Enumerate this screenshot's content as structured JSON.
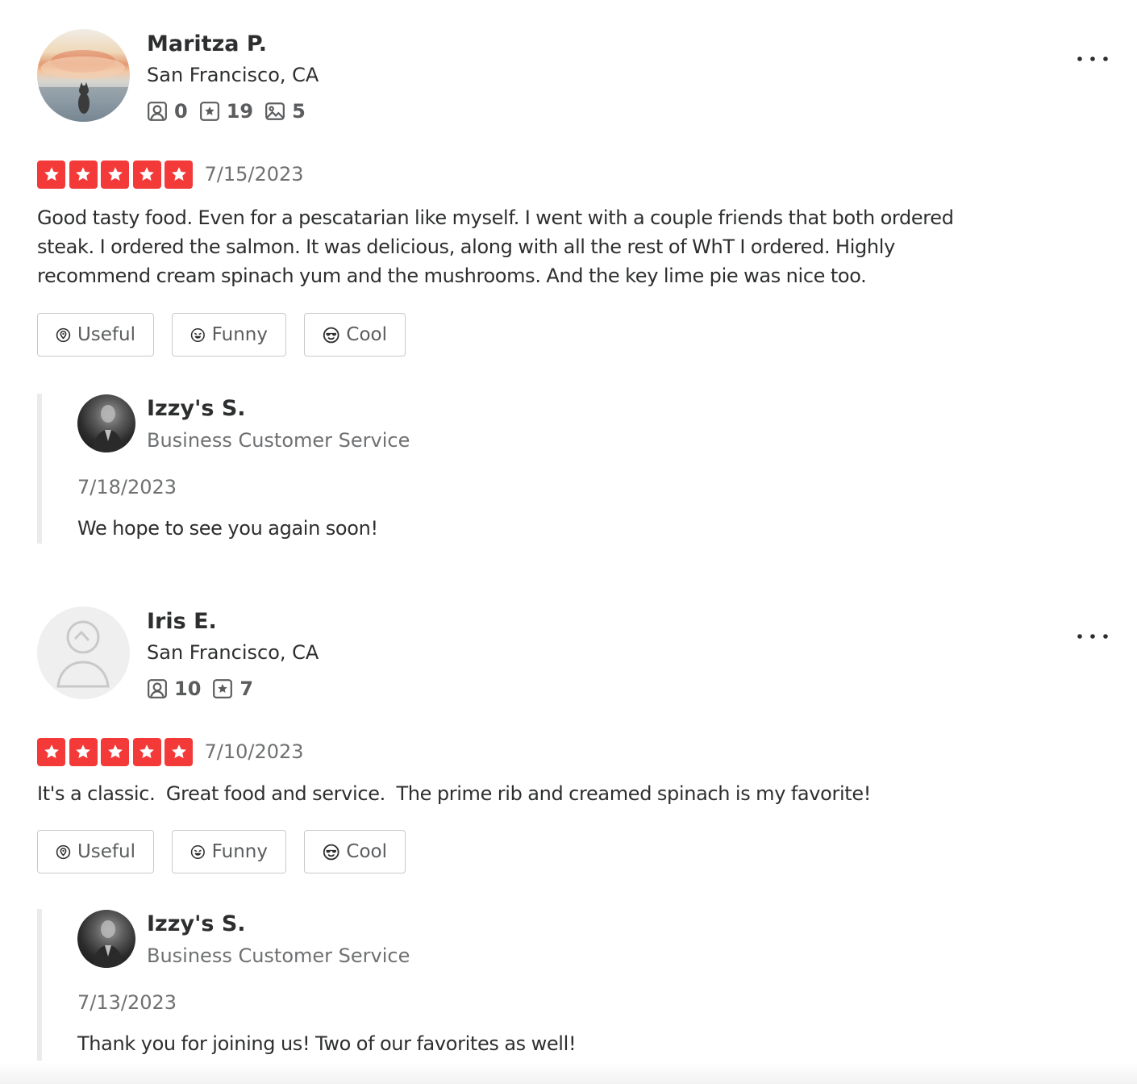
{
  "reviews": [
    {
      "reviewer": {
        "name": "Maritza P.",
        "location": "San Francisco, CA",
        "avatar": "cat-photo",
        "stats": {
          "friends": "0",
          "reviews": "19",
          "photos": "5"
        }
      },
      "rating": 5,
      "date": "7/15/2023",
      "text": "Good tasty food. Even for a pescatarian like myself. I went with a couple friends that both ordered steak. I ordered the salmon. It was delicious, along with all the rest of WhT I ordered. Highly recommend cream spinach yum and the mushrooms. And the key lime pie was nice too.",
      "actions": {
        "useful": "Useful",
        "funny": "Funny",
        "cool": "Cool"
      },
      "reply": {
        "name": "Izzy's S.",
        "role": "Business Customer Service",
        "date": "7/18/2023",
        "text": "We hope to see you again soon!"
      }
    },
    {
      "reviewer": {
        "name": "Iris E.",
        "location": "San Francisco, CA",
        "avatar": "default-user",
        "stats": {
          "friends": "10",
          "reviews": "7"
        }
      },
      "rating": 5,
      "date": "7/10/2023",
      "text": "It's a classic.  Great food and service.  The prime rib and creamed spinach is my favorite!",
      "actions": {
        "useful": "Useful",
        "funny": "Funny",
        "cool": "Cool"
      },
      "reply": {
        "name": "Izzy's S.",
        "role": "Business Customer Service",
        "date": "7/13/2023",
        "text": "Thank you for joining us! Two of our favorites as well!"
      }
    }
  ],
  "colors": {
    "star_red": "#f43939",
    "text_primary": "#2d2e2f",
    "text_secondary": "#6e7072",
    "border": "#c8c9ca",
    "reply_bar": "#ebebeb"
  }
}
